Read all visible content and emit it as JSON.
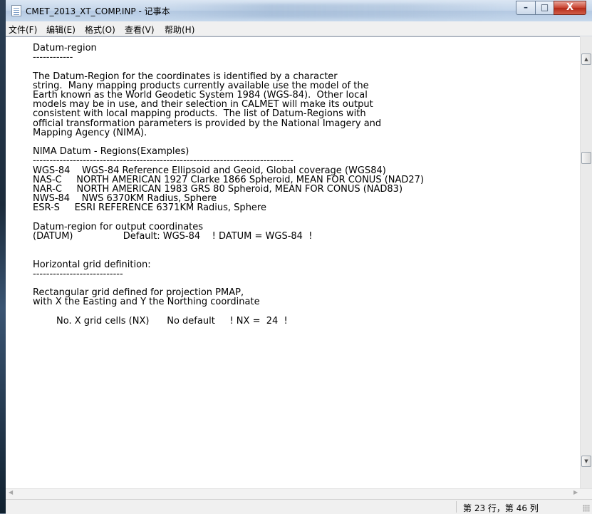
{
  "window": {
    "title": "CMET_2013_XT_COMP.INP - 记事本",
    "minimize_symbol": "–",
    "maximize_symbol": "□",
    "close_symbol": "X"
  },
  "menu": {
    "file": "文件(F)",
    "edit": "编辑(E)",
    "format": "格式(O)",
    "view": "查看(V)",
    "help": "帮助(H)"
  },
  "document": {
    "text": "Datum-region\n------------\n\nThe Datum-Region for the coordinates is identified by a character\nstring.  Many mapping products currently available use the model of the\nEarth known as the World Geodetic System 1984 (WGS-84).  Other local\nmodels may be in use, and their selection in CALMET will make its output\nconsistent with local mapping products.  The list of Datum-Regions with\nofficial transformation parameters is provided by the National Imagery and\nMapping Agency (NIMA).\n\nNIMA Datum - Regions(Examples)\n------------------------------------------------------------------------------\nWGS-84    WGS-84 Reference Ellipsoid and Geoid, Global coverage (WGS84)\nNAS-C     NORTH AMERICAN 1927 Clarke 1866 Spheroid, MEAN FOR CONUS (NAD27)\nNAR-C     NORTH AMERICAN 1983 GRS 80 Spheroid, MEAN FOR CONUS (NAD83)\nNWS-84    NWS 6370KM Radius, Sphere\nESR-S     ESRI REFERENCE 6371KM Radius, Sphere\n\nDatum-region for output coordinates\n(DATUM)                 Default: WGS-84    ! DATUM = WGS-84  !\n\n\nHorizontal grid definition:\n---------------------------\n\nRectangular grid defined for projection PMAP,\nwith X the Easting and Y the Northing coordinate\n\n        No. X grid cells (NX)      No default     ! NX =  24  !"
  },
  "scrollbar": {
    "up_arrow": "▲",
    "down_arrow": "▼",
    "left_arrow": "◀",
    "right_arrow": "▶"
  },
  "status": {
    "position": "第 23 行，第 46 列"
  }
}
